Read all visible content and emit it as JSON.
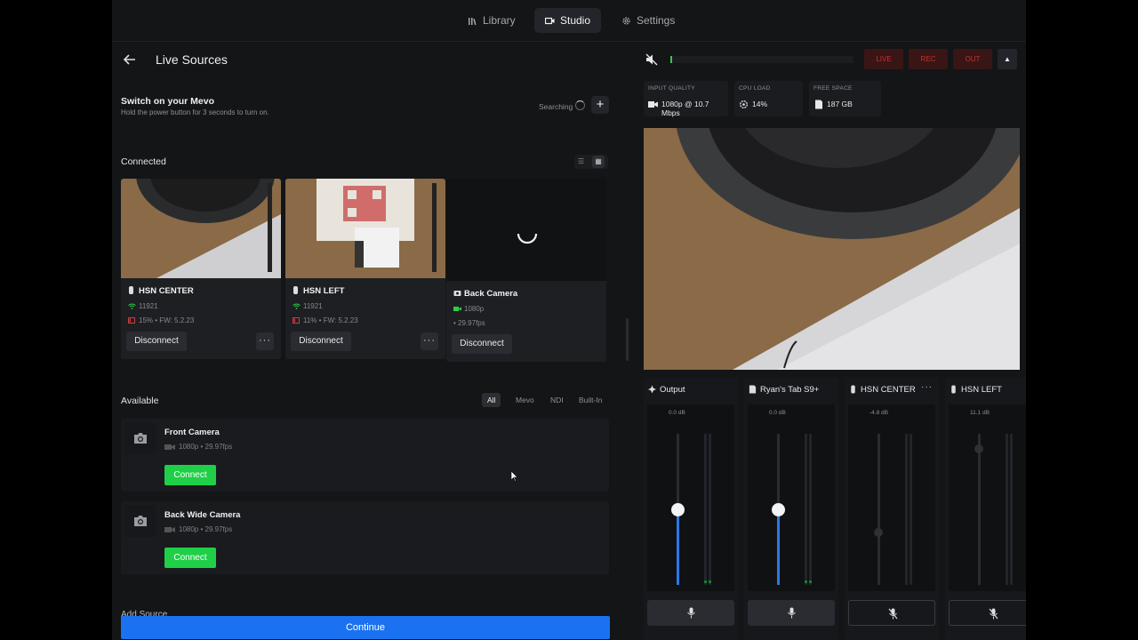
{
  "nav": {
    "tabs": [
      {
        "label": "Library",
        "icon": "library-icon"
      },
      {
        "label": "Studio",
        "icon": "studio-icon",
        "active": true
      },
      {
        "label": "Settings",
        "icon": "gear-icon"
      }
    ]
  },
  "left": {
    "title": "Live Sources",
    "switch_title": "Switch on your Mevo",
    "switch_sub": "Hold the power button for 3 seconds to turn on.",
    "searching": "Searching",
    "connected_label": "Connected",
    "available_label": "Available",
    "connected": [
      {
        "name": "HSN CENTER",
        "serial": "11921",
        "battery": "15%",
        "firmware": "FW: 5.2.23",
        "action": "Disconnect"
      },
      {
        "name": "HSN LEFT",
        "serial": "11921",
        "battery": "11%",
        "firmware": "FW: 5.2.23",
        "action": "Disconnect"
      },
      {
        "name": "Back Camera",
        "resolution": "1080p",
        "fps": "29.97fps",
        "action": "Disconnect"
      }
    ],
    "filters": [
      "All",
      "Mevo",
      "NDI",
      "Built-In"
    ],
    "available": [
      {
        "name": "Front Camera",
        "resolution": "1080p",
        "fps": "29.97fps",
        "action": "Connect"
      },
      {
        "name": "Back Wide Camera",
        "resolution": "1080p",
        "fps": "29.97fps",
        "action": "Connect"
      }
    ],
    "add_source": "Add Source",
    "continue": "Continue",
    "separator": "•"
  },
  "right": {
    "buttons": {
      "live": "LIVE",
      "rec": "REC",
      "out": "OUT"
    },
    "stats": [
      {
        "label": "INPUT QUALITY",
        "value": "1080p @ 10.7 Mbps"
      },
      {
        "label": "CPU LOAD",
        "value": "14%"
      },
      {
        "label": "FREE SPACE",
        "value": "187 GB"
      }
    ],
    "mixer": [
      {
        "name": "Output",
        "db": "0.0 dB",
        "level": 0.5,
        "muted": false
      },
      {
        "name": "Ryan's Tab S9+",
        "db": "0.0 dB",
        "level": 0.5,
        "muted": false
      },
      {
        "name": "HSN CENTER",
        "db": "-4.8 dB",
        "level": 0.35,
        "muted": true
      },
      {
        "name": "HSN LEFT",
        "db": "11.1 dB",
        "level": 0.9,
        "muted": true
      }
    ]
  },
  "colors": {
    "accent": "#1a72f0",
    "connect": "#1fcf47",
    "live_bg": "#3a1515",
    "live_text": "#c0342d"
  }
}
